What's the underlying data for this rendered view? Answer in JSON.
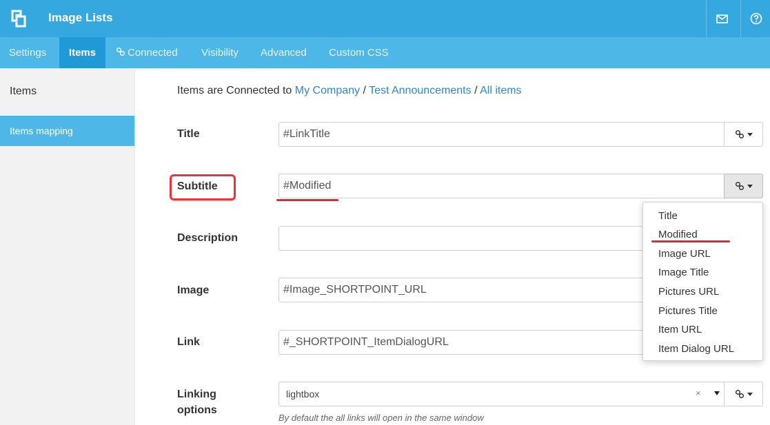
{
  "header": {
    "title": "Image Lists",
    "logo_icon": "shortpoint-logo-icon",
    "actions": [
      "mail-icon",
      "help-icon"
    ]
  },
  "tabs": [
    {
      "label": "Settings"
    },
    {
      "label": "Items",
      "active": true
    },
    {
      "label": "Connected",
      "icon": "link-icon"
    },
    {
      "label": "Visibility"
    },
    {
      "label": "Advanced"
    },
    {
      "label": "Custom CSS"
    }
  ],
  "sidebar": {
    "heading": "Items",
    "items": [
      {
        "label": "Items mapping",
        "active": true
      }
    ]
  },
  "breadcrumb": {
    "prefix": "Items are Connected to",
    "separator": "/",
    "links": [
      "My Company",
      "Test Announcements",
      "All items"
    ]
  },
  "fields": {
    "title": {
      "label": "Title",
      "value": "#LinkTitle"
    },
    "subtitle": {
      "label": "Subtitle",
      "value": "#Modified"
    },
    "description": {
      "label": "Description",
      "value": ""
    },
    "image": {
      "label": "Image",
      "value": "#Image_SHORTPOINT_URL"
    },
    "link": {
      "label": "Link",
      "value": "#_SHORTPOINT_ItemDialogURL"
    },
    "linking": {
      "label_line1": "Linking",
      "label_line2": "options",
      "value": "lightbox",
      "clear_glyph": "×",
      "hint": "By default the all links will open in the same window"
    }
  },
  "dropdown": {
    "items": [
      "Title",
      "Modified",
      "Image URL",
      "Image Title",
      "Pictures URL",
      "Pictures Title",
      "Item URL",
      "Item Dialog URL"
    ]
  },
  "colors": {
    "header": "#35a8df",
    "tabbar": "#4db7e8",
    "tab_active": "#1f9ad6",
    "link": "#2a8ac8",
    "annotation": "#ee3333"
  }
}
